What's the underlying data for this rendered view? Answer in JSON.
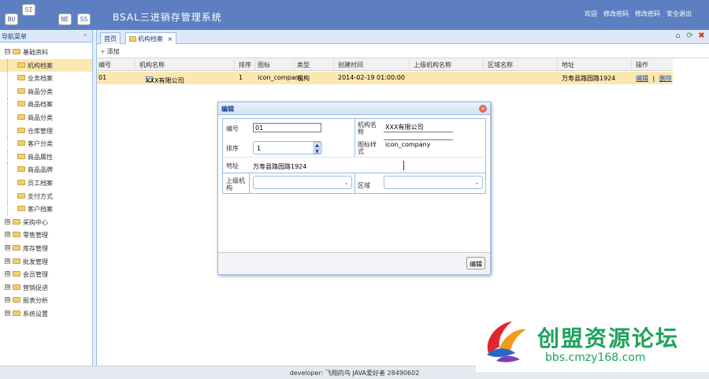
{
  "header": {
    "logo_letters": [
      "BU",
      "SI",
      "NE",
      "SS"
    ],
    "title": "BSAL三进销存管理系统",
    "links": [
      "欢迎",
      "修改密码",
      "修改密码",
      "安全退出"
    ]
  },
  "sidebar": {
    "title": "导航菜单",
    "collapse_icon": "«",
    "items": [
      {
        "label": "基础资料",
        "expand": "⊟"
      },
      {
        "label": "机构档案"
      },
      {
        "label": "业务档案"
      },
      {
        "label": "商品分类"
      },
      {
        "label": "商品档案"
      },
      {
        "label": "商品分类"
      },
      {
        "label": "仓库管理"
      },
      {
        "label": "客户分类"
      },
      {
        "label": "商品属性"
      },
      {
        "label": "商品品牌"
      },
      {
        "label": "员工档案"
      },
      {
        "label": "支付方式"
      },
      {
        "label": "客户档案"
      },
      {
        "label": "采购中心",
        "expand": "⊞"
      },
      {
        "label": "零售管理",
        "expand": "⊞"
      },
      {
        "label": "库存管理",
        "expand": "⊞"
      },
      {
        "label": "批发管理",
        "expand": "⊞"
      },
      {
        "label": "会员管理",
        "expand": "⊞"
      },
      {
        "label": "营销促进",
        "expand": "⊞"
      },
      {
        "label": "报表分析",
        "expand": "⊞"
      },
      {
        "label": "系统设置",
        "expand": "⊞"
      }
    ]
  },
  "tabs": [
    {
      "label": "首页"
    },
    {
      "label": "机构档案",
      "close": "×"
    }
  ],
  "tab_tools": [
    "⌂",
    "⟳",
    "✖"
  ],
  "toolbar": {
    "add_label": "添加",
    "add_icon": "+"
  },
  "grid": {
    "columns": [
      "编号",
      "机构名称",
      "排序",
      "图标",
      "类型",
      "创建时间",
      "上级机构名称",
      "区域名称",
      "地址",
      "操作"
    ],
    "rows": [
      {
        "code": "01",
        "name": "XXX有限公司",
        "sort": "1",
        "icon": "icon_company",
        "type": "机构",
        "created": "2014-02-19 01:00:00",
        "parent": "",
        "region": "",
        "address": "万寿县路园路1924",
        "op_edit": "编辑",
        "op_sep": "|",
        "op_delete": "删除"
      }
    ]
  },
  "dialog": {
    "title": "编辑",
    "close": "×",
    "fields": {
      "code_label": "编号",
      "code_value": "01",
      "name_label": "机构名称",
      "name_value": "XXX有限公司",
      "sort_label": "排序",
      "sort_value": "1",
      "icon_label": "图标样式",
      "icon_value": "icon_company",
      "address_label": "地址",
      "address_value": "万寿县路园路1924",
      "parent_label": "上级机构",
      "region_label": "区域"
    },
    "spin_up": "▲",
    "spin_down": "▼",
    "combo_arrow": "⌄",
    "save_button": "编辑"
  },
  "footer": {
    "text": "developer: 飞翔的鸟 JAVA爱好者 28490602"
  },
  "watermark": {
    "cn": "创盟资源论坛",
    "url": "bbs.cmzy168.com"
  }
}
